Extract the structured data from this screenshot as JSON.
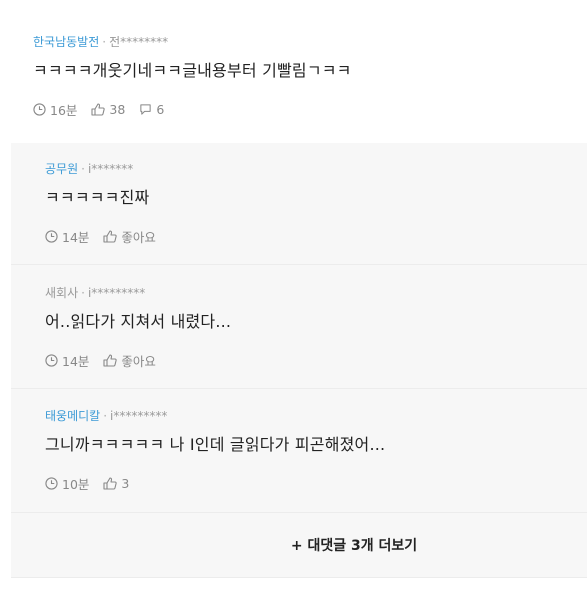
{
  "comments": [
    {
      "nickname": "한국남동발전",
      "user_id": "전********",
      "text": "ㅋㅋㅋㅋ개웃기네ㅋㅋ글내용부터 기빨림ㄱㅋㅋ",
      "time": "16분",
      "likes": "38",
      "replies": "6"
    }
  ],
  "replies": [
    {
      "nickname": "공무원",
      "user_id": "i*******",
      "text": "ㅋㅋㅋㅋㅋ진짜",
      "time": "14분",
      "likes": "좋아요"
    },
    {
      "nickname": "새회사",
      "user_id": "i*********",
      "text": "어..읽다가 지쳐서 내렸다...",
      "time": "14분",
      "likes": "좋아요"
    },
    {
      "nickname": "태웅메디칼",
      "user_id": "i*********",
      "text": "그니까ㅋㅋㅋㅋㅋ 나 I인데 글읽다가 피곤해졌어...",
      "time": "10분",
      "likes": "3"
    }
  ],
  "more_replies_label": "+ 대댓글 3개 더보기",
  "meta_separator": "·",
  "colors": {
    "nickname": "#3d9bd6",
    "reply_background": "#f7f7f7"
  },
  "icons": {
    "time": "clock-icon",
    "like": "thumbs-up-icon",
    "reply": "speech-bubble-icon"
  }
}
